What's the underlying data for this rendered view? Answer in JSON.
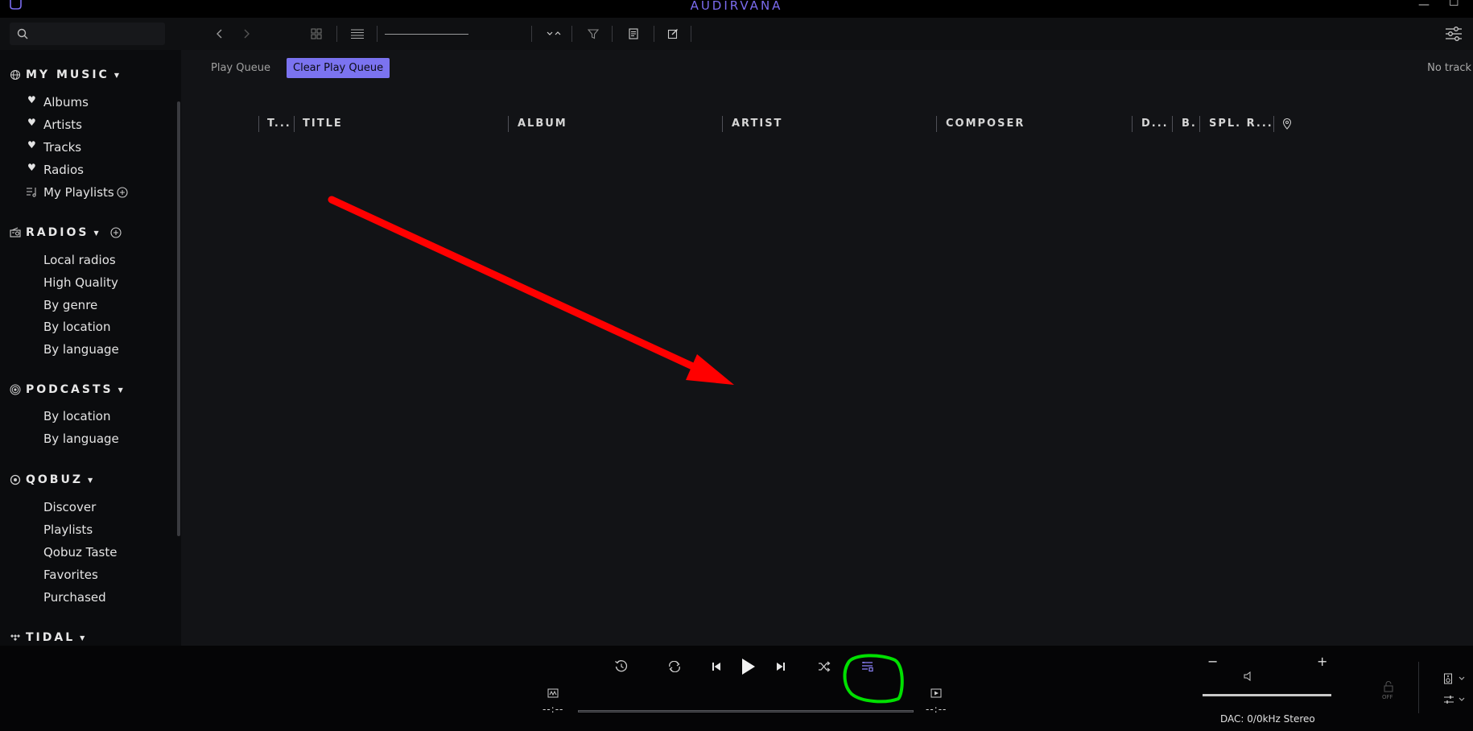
{
  "app": {
    "title": "AUDIRVANA"
  },
  "search": {
    "placeholder": ""
  },
  "sidebar": {
    "my_music": {
      "title": "MY MUSIC",
      "items": [
        "Albums",
        "Artists",
        "Tracks",
        "Radios"
      ],
      "playlists": "My Playlists"
    },
    "radios": {
      "title": "RADIOS",
      "items": [
        "Local radios",
        "High Quality",
        "By genre",
        "By location",
        "By language"
      ]
    },
    "podcasts": {
      "title": "PODCASTS",
      "items": [
        "By location",
        "By language"
      ]
    },
    "qobuz": {
      "title": "QOBUZ",
      "items": [
        "Discover",
        "Playlists",
        "Qobuz Taste",
        "Favorites",
        "Purchased"
      ]
    },
    "tidal": {
      "title": "TIDAL"
    }
  },
  "main": {
    "tab": "Play Queue",
    "clear_button": "Clear Play Queue",
    "status": "No track",
    "columns": [
      "T...",
      "TITLE",
      "ALBUM",
      "ARTIST",
      "COMPOSER",
      "D...",
      "B.",
      "SPL. R..."
    ]
  },
  "player": {
    "elapsed": "--:--",
    "remaining": "--:--",
    "dac": "DAC: 0/0kHz Stereo",
    "volume_off": "OFF",
    "volume_minus": "−",
    "volume_plus": "+"
  },
  "annotation": {
    "arrow_color": "#ff0000",
    "highlight_color": "#00e000"
  },
  "colors": {
    "accent": "#7b73f0"
  }
}
